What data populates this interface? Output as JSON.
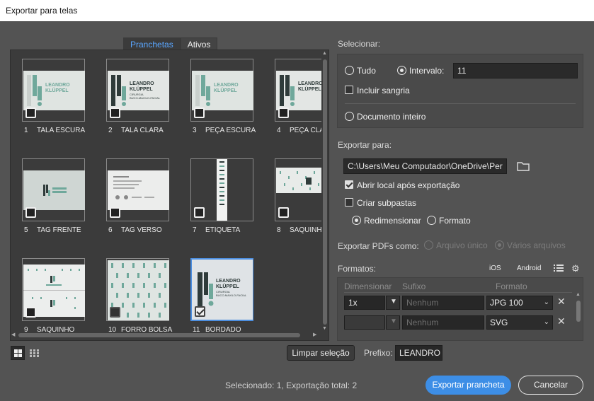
{
  "window": {
    "title": "Exportar para telas"
  },
  "tabs": [
    {
      "label": "Pranchetas",
      "active": true
    },
    {
      "label": "Ativos",
      "active": false
    }
  ],
  "artboards": [
    {
      "number": "1",
      "name": "TALA ESCURA",
      "checked": false,
      "selected": false
    },
    {
      "number": "2",
      "name": "TALA CLARA",
      "checked": false,
      "selected": false
    },
    {
      "number": "3",
      "name": "PEÇA ESCURA",
      "checked": false,
      "selected": false
    },
    {
      "number": "4",
      "name": "PEÇA CLAR",
      "checked": false,
      "selected": false
    },
    {
      "number": "5",
      "name": "TAG FRENTE",
      "checked": false,
      "selected": false
    },
    {
      "number": "6",
      "name": "TAG VERSO",
      "checked": false,
      "selected": false
    },
    {
      "number": "7",
      "name": "ETIQUETA",
      "checked": false,
      "selected": false
    },
    {
      "number": "8",
      "name": "SAQUINH",
      "checked": false,
      "selected": false
    },
    {
      "number": "9",
      "name": "SAQUINHO",
      "checked": false,
      "selected": false
    },
    {
      "number": "10",
      "name": "FORRO BOLSA",
      "checked": false,
      "selected": false
    },
    {
      "number": "11",
      "name": "BORDADO",
      "checked": true,
      "selected": true
    }
  ],
  "logo": {
    "line1": "LEANDRO",
    "line2": "KLÜPPEL",
    "line3": "CIRURGIA",
    "line4": "BUCO-MAXILO-FACIAL"
  },
  "bottom_left": {
    "clear_selection": "Limpar seleção",
    "prefix_label": "Prefixo:",
    "prefix_value": "LEANDRO I"
  },
  "select": {
    "heading": "Selecionar:",
    "all_label": "Tudo",
    "range_label": "Intervalo:",
    "range_value": "11",
    "bleed_label": "Incluir sangria",
    "whole_doc_label": "Documento inteiro"
  },
  "export_to": {
    "heading": "Exportar para:",
    "path": "C:\\Users\\Meu Computador\\OneDrive\\Per",
    "open_location_label": "Abrir local após exportação",
    "subfolders_label": "Criar subpastas",
    "resize_label": "Redimensionar",
    "format_label": "Formato"
  },
  "pdf": {
    "heading": "Exportar PDFs como:",
    "single_label": "Arquivo único",
    "multi_label": "Vários arquivos"
  },
  "formats": {
    "heading": "Formatos:",
    "ios_label": "iOS",
    "android_label": "Android",
    "col_scale": "Dimensionar",
    "col_suffix": "Sufixo",
    "col_format": "Formato",
    "rows": [
      {
        "scale": "1x",
        "suffix_placeholder": "Nenhum",
        "format": "JPG 100"
      },
      {
        "scale": "",
        "suffix_placeholder": "Nenhum",
        "format": "SVG"
      }
    ]
  },
  "footer": {
    "status": "Selecionado: 1, Exportação total: 2",
    "export_button": "Exportar prancheta",
    "cancel_button": "Cancelar"
  },
  "colors": {
    "background": "#535353",
    "accent": "#3d8ee6",
    "panel": "#3b3b3b",
    "logo_green": "#6fa89b",
    "logo_dark": "#2f3b3a"
  }
}
